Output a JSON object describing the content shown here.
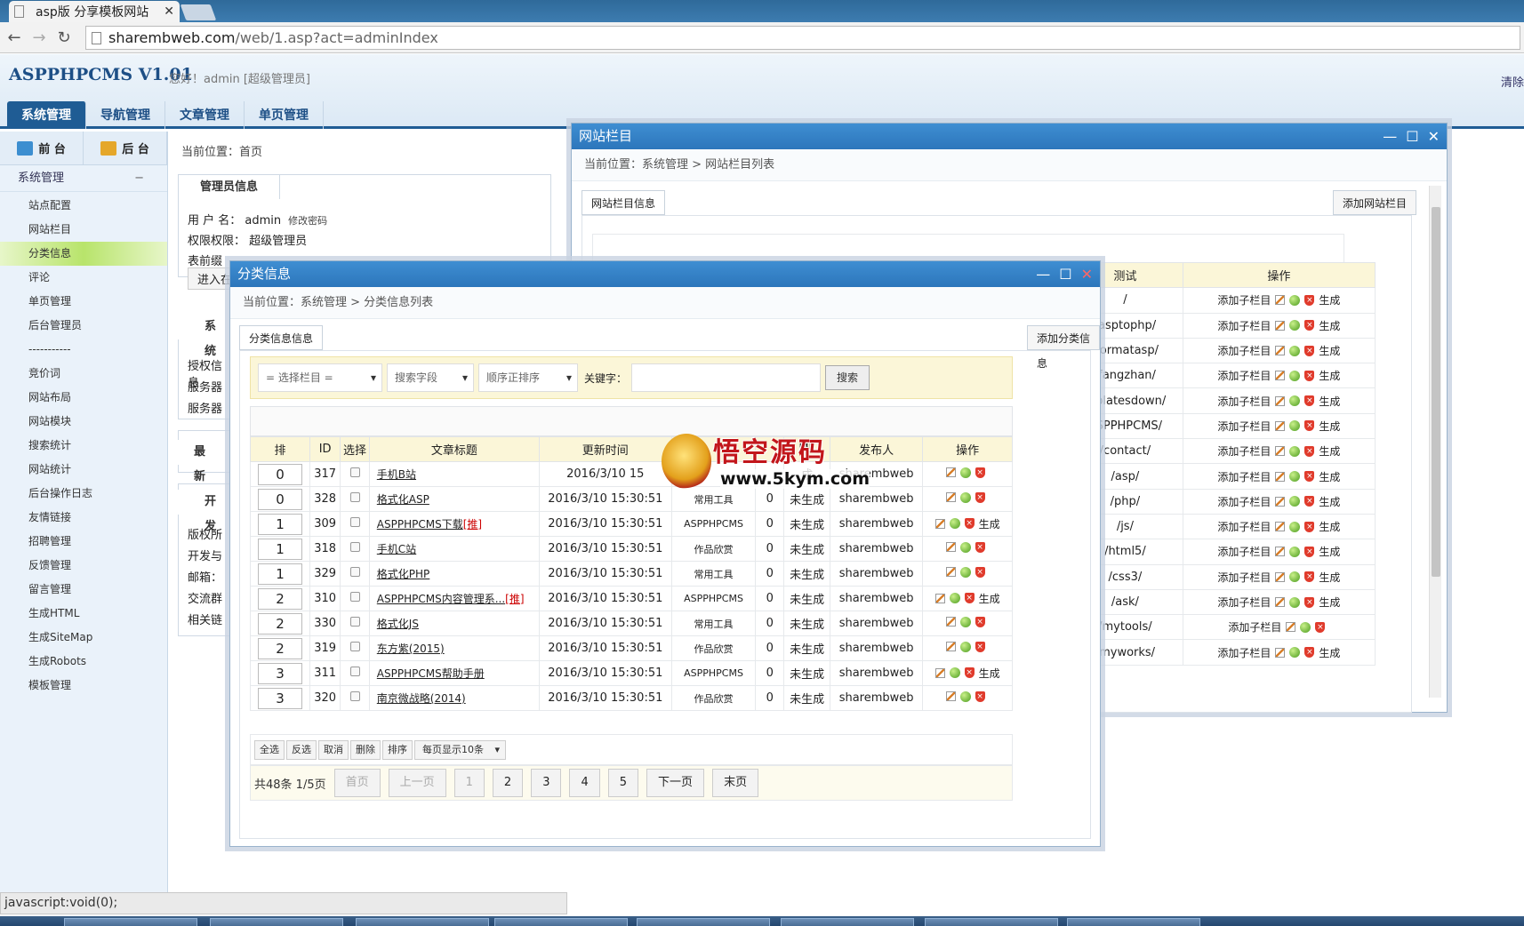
{
  "browser": {
    "tab_title": "asp版 分享模板网站",
    "tab_close": "✕",
    "url_host": "sharembweb.com",
    "url_path": "/web/1.asp?act=adminIndex",
    "status_text": "javascript:void(0);"
  },
  "header": {
    "logo": "ASPPHPCMS V1.01",
    "greeting": "您好！admin [超级管理员]",
    "clear_link": "清除",
    "nav": [
      "系统管理",
      "导航管理",
      "文章管理",
      "单页管理"
    ]
  },
  "sidebar": {
    "front_label": "前 台",
    "back_label": "后 台",
    "section_title": "系统管理",
    "section_toggle": "−",
    "items": [
      "站点配置",
      "网站栏目",
      "分类信息",
      "评论",
      "单页管理",
      "后台管理员",
      "-----------",
      "竞价词",
      "网站布局",
      "网站模块",
      "搜索统计",
      "网站统计",
      "后台操作日志",
      "友情链接",
      "招聘管理",
      "反馈管理",
      "留言管理",
      "生成HTML",
      "生成SiteMap",
      "生成Robots",
      "模板管理"
    ],
    "active_index": 2
  },
  "main": {
    "crumb": "当前位置：首页",
    "admin_tab": "管理员信息",
    "user_line": "用 户 名：  admin",
    "change_pwd": "修改密码",
    "perm_line": "权限权限：  超级管理员",
    "frag1": "表前缀",
    "frag_btn": "进入在",
    "sys_tab": "系统",
    "info": [
      "授权信息",
      "服务器",
      "服务器"
    ],
    "recent_tab": "最新访",
    "dev_tab": "开发",
    "dev_lines": [
      "版权所",
      "开发与",
      "邮箱：",
      "交流群",
      "相关链"
    ]
  },
  "win_site": {
    "title": "网站栏目",
    "crumb": "当前位置：系统管理 > 网站栏目列表",
    "tab": "网站栏目信息",
    "add_button": "添加网站栏目",
    "headers": [
      "测试",
      "操作"
    ],
    "rows": [
      {
        "path": "/",
        "add": "添加子栏目",
        "gen": "生成"
      },
      {
        "path": "/asptophp/",
        "add": "添加子栏目",
        "gen": "生成"
      },
      {
        "path": "/formatasp/",
        "add": "添加子栏目",
        "gen": "生成"
      },
      {
        "path": "/fangzhan/",
        "add": "添加子栏目",
        "gen": "生成"
      },
      {
        "path": "mplatesdown/",
        "add": "添加子栏目",
        "gen": "生成"
      },
      {
        "path": "ASPPHPCMS/",
        "add": "添加子栏目",
        "gen": "生成"
      },
      {
        "path": "/contact/",
        "add": "添加子栏目",
        "gen": "生成"
      },
      {
        "path": "/asp/",
        "add": "添加子栏目",
        "gen": "生成"
      },
      {
        "path": "/php/",
        "add": "添加子栏目",
        "gen": "生成"
      },
      {
        "path": "/js/",
        "add": "添加子栏目",
        "gen": "生成"
      },
      {
        "path": "/html5/",
        "add": "添加子栏目",
        "gen": "生成"
      },
      {
        "path": "/css3/",
        "add": "添加子栏目",
        "gen": "生成"
      },
      {
        "path": "/ask/",
        "add": "添加子栏目",
        "gen": "生成"
      },
      {
        "path": "/mytools/",
        "add": "添加子栏目",
        "gen": ""
      },
      {
        "path": "/myworks/",
        "add": "添加子栏目",
        "gen": "生成"
      }
    ]
  },
  "win_cat": {
    "title": "分类信息",
    "crumb": "当前位置：系统管理 > 分类信息列表",
    "tab": "分类信息信息",
    "add_button": "添加分类信息",
    "select_column": "= 选择栏目 =",
    "search_field": "搜索字段",
    "order": "顺序正排序",
    "keyword_label": "关键字：",
    "search_button": "搜索",
    "headers": [
      "排",
      "ID",
      "选择",
      "文章标题",
      "更新时间",
      "",
      "",
      "ML",
      "发布人",
      "操作"
    ],
    "rows": [
      {
        "sort": "0",
        "id": "317",
        "title": "手机B站",
        "tui": "",
        "time": "2016/3/10 15",
        "cat": "",
        "views": "",
        "html": "成",
        "author": "sharembweb",
        "gen": ""
      },
      {
        "sort": "0",
        "id": "328",
        "title": "格式化ASP",
        "tui": "",
        "time": "2016/3/10 15:30:51",
        "cat": "常用工具",
        "views": "0",
        "html": "未生成",
        "author": "sharembweb",
        "gen": ""
      },
      {
        "sort": "1",
        "id": "309",
        "title": "ASPPHPCMS下载",
        "tui": "[推]",
        "time": "2016/3/10 15:30:51",
        "cat": "ASPPHPCMS",
        "views": "0",
        "html": "未生成",
        "author": "sharembweb",
        "gen": "生成"
      },
      {
        "sort": "1",
        "id": "318",
        "title": "手机C站",
        "tui": "",
        "time": "2016/3/10 15:30:51",
        "cat": "作品欣赏",
        "views": "0",
        "html": "未生成",
        "author": "sharembweb",
        "gen": ""
      },
      {
        "sort": "1",
        "id": "329",
        "title": "格式化PHP",
        "tui": "",
        "time": "2016/3/10 15:30:51",
        "cat": "常用工具",
        "views": "0",
        "html": "未生成",
        "author": "sharembweb",
        "gen": ""
      },
      {
        "sort": "2",
        "id": "310",
        "title": "ASPPHPCMS内容管理系...",
        "tui": "[推]",
        "time": "2016/3/10 15:30:51",
        "cat": "ASPPHPCMS",
        "views": "0",
        "html": "未生成",
        "author": "sharembweb",
        "gen": "生成"
      },
      {
        "sort": "2",
        "id": "330",
        "title": "格式化JS",
        "tui": "",
        "time": "2016/3/10 15:30:51",
        "cat": "常用工具",
        "views": "0",
        "html": "未生成",
        "author": "sharembweb",
        "gen": ""
      },
      {
        "sort": "2",
        "id": "319",
        "title": "东方紫(2015)",
        "tui": "",
        "time": "2016/3/10 15:30:51",
        "cat": "作品欣赏",
        "views": "0",
        "html": "未生成",
        "author": "sharembweb",
        "gen": ""
      },
      {
        "sort": "3",
        "id": "311",
        "title": "ASPPHPCMS帮助手册",
        "tui": "",
        "time": "2016/3/10 15:30:51",
        "cat": "ASPPHPCMS",
        "views": "0",
        "html": "未生成",
        "author": "sharembweb",
        "gen": "生成"
      },
      {
        "sort": "3",
        "id": "320",
        "title": "南京微战略(2014)",
        "tui": "",
        "time": "2016/3/10 15:30:51",
        "cat": "作品欣赏",
        "views": "0",
        "html": "未生成",
        "author": "sharembweb",
        "gen": ""
      }
    ],
    "bulk_buttons": [
      "全选",
      "反选",
      "取消",
      "删除",
      "排序"
    ],
    "per_page": "每页显示10条",
    "pager_info": "共48条 1/5页",
    "pager": [
      "首页",
      "上一页",
      "1",
      "2",
      "3",
      "4",
      "5",
      "下一页",
      "末页"
    ]
  },
  "watermark": {
    "text": "悟空源码",
    "url": "www.5kym.com"
  },
  "colors": {
    "primary": "#1f5c94",
    "title_bar": "#2c76bb",
    "table_head": "#fbf6d8",
    "active_item": "#b8e46b"
  }
}
